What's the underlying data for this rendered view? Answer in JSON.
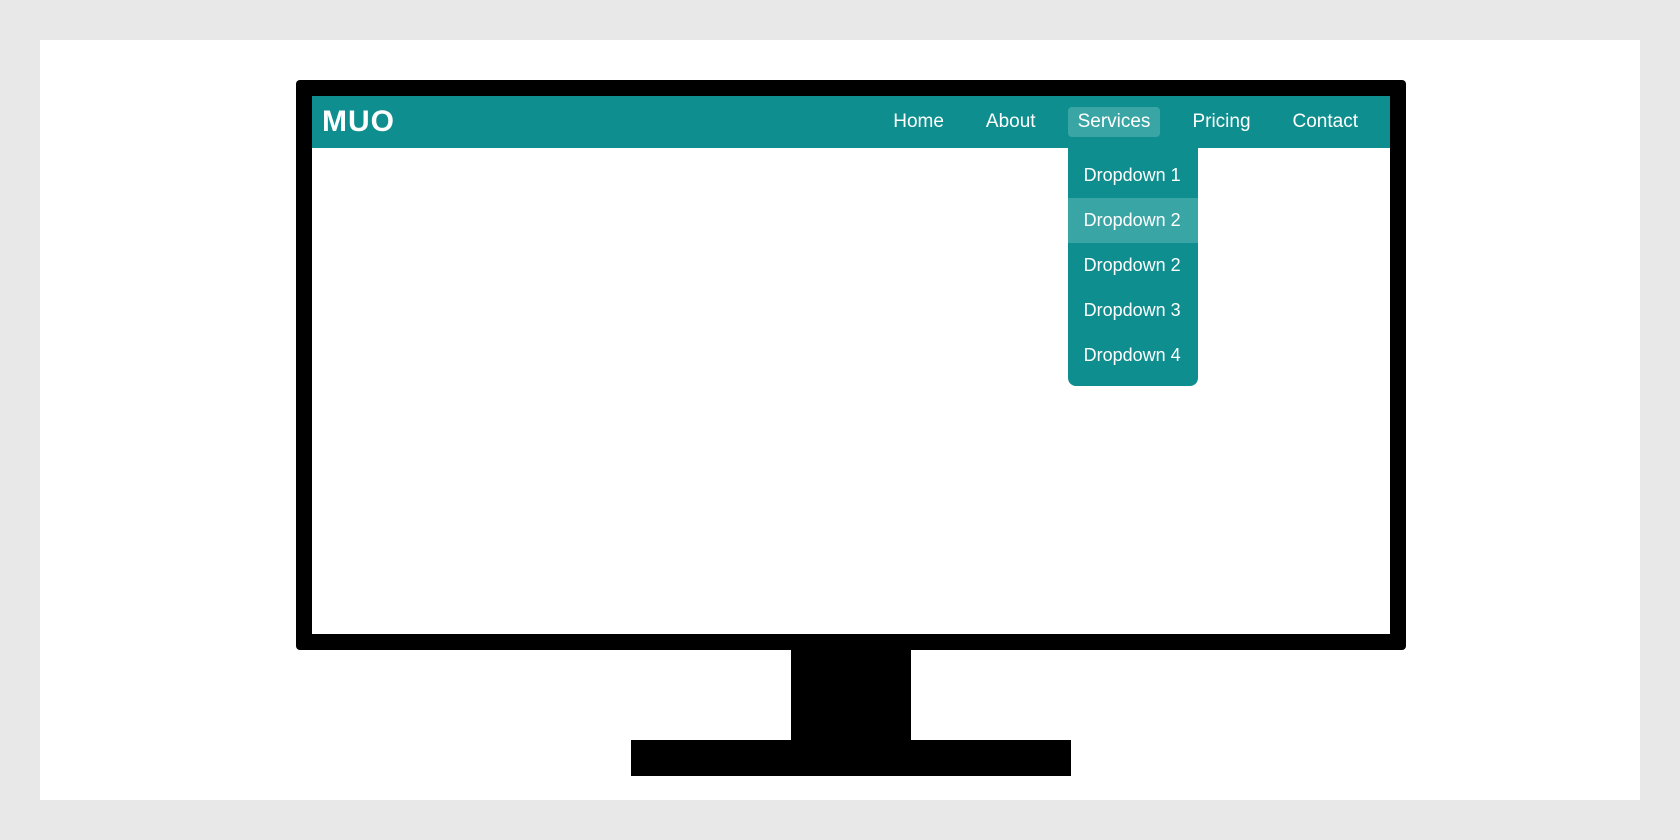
{
  "logo": "MUO",
  "nav": {
    "items": [
      {
        "label": "Home"
      },
      {
        "label": "About"
      },
      {
        "label": "Services",
        "active": true
      },
      {
        "label": "Pricing"
      },
      {
        "label": "Contact"
      }
    ]
  },
  "dropdown": {
    "items": [
      {
        "label": "Dropdown 1"
      },
      {
        "label": "Dropdown 2",
        "highlight": true
      },
      {
        "label": "Dropdown 2"
      },
      {
        "label": "Dropdown 3"
      },
      {
        "label": "Dropdown 4"
      }
    ]
  },
  "colors": {
    "navbar": "#0e8e8e",
    "highlight": "#3aa5a5",
    "page_bg": "#e8e8e8"
  }
}
